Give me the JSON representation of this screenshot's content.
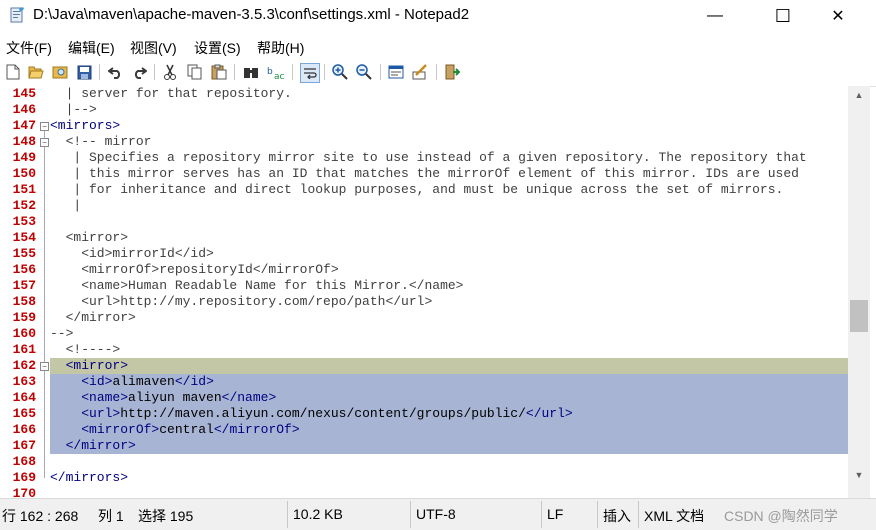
{
  "window": {
    "title": "D:\\Java\\maven\\apache-maven-3.5.3\\conf\\settings.xml - Notepad2",
    "minimize_glyph": "—",
    "maximize_glyph": "☐",
    "close_glyph": "✕"
  },
  "menu": {
    "items": [
      "文件(F)",
      "编辑(E)",
      "视图(V)",
      "设置(S)",
      "帮助(H)"
    ]
  },
  "toolbar": {
    "icons": [
      "new-file-icon",
      "open-file-icon",
      "browse-icon",
      "save-icon",
      "undo-icon",
      "redo-icon",
      "cut-icon",
      "copy-icon",
      "paste-icon",
      "find-icon",
      "replace-icon",
      "word-wrap-icon",
      "zoom-in-icon",
      "zoom-out-icon",
      "select-scheme-icon",
      "customize-scheme-icon",
      "exit-icon"
    ]
  },
  "editor": {
    "colors": {
      "tag": "#000080",
      "comment": "#404040",
      "line_number": "#c00000",
      "selection": "#a8b4d4",
      "caret_line": "#c3c7a6"
    },
    "lines": [
      {
        "num": "145",
        "text": "  | server for that repository."
      },
      {
        "num": "146",
        "text": "  |-->"
      },
      {
        "num": "147",
        "text": "<mirrors>"
      },
      {
        "num": "148",
        "text": "  <!-- mirror"
      },
      {
        "num": "149",
        "text": "   | Specifies a repository mirror site to use instead of a given repository. The repository that"
      },
      {
        "num": "150",
        "text": "   | this mirror serves has an ID that matches the mirrorOf element of this mirror. IDs are used"
      },
      {
        "num": "151",
        "text": "   | for inheritance and direct lookup purposes, and must be unique across the set of mirrors."
      },
      {
        "num": "152",
        "text": "   |"
      },
      {
        "num": "153",
        "text": ""
      },
      {
        "num": "154",
        "text": "  <mirror>"
      },
      {
        "num": "155",
        "text": "    <id>mirrorId</id>"
      },
      {
        "num": "156",
        "text": "    <mirrorOf>repositoryId</mirrorOf>"
      },
      {
        "num": "157",
        "text": "    <name>Human Readable Name for this Mirror.</name>"
      },
      {
        "num": "158",
        "text": "    <url>http://my.repository.com/repo/path</url>"
      },
      {
        "num": "159",
        "text": "  </mirror>"
      },
      {
        "num": "160",
        "text": "-->"
      },
      {
        "num": "161",
        "text": "  <!---->"
      },
      {
        "num": "162",
        "text": "  <mirror>"
      },
      {
        "num": "163",
        "text": "    <id>alimaven</id>"
      },
      {
        "num": "164",
        "text": "    <name>aliyun maven</name>"
      },
      {
        "num": "165",
        "text": "    <url>http://maven.aliyun.com/nexus/content/groups/public/</url>"
      },
      {
        "num": "166",
        "text": "    <mirrorOf>central</mirrorOf>"
      },
      {
        "num": "167",
        "text": "  </mirror>"
      },
      {
        "num": "168",
        "text": ""
      },
      {
        "num": "169",
        "text": "</mirrors>"
      },
      {
        "num": "170",
        "text": ""
      }
    ]
  },
  "status": {
    "position": "行 162 : 268",
    "column": "列 1",
    "selection": "选择 195",
    "size": "10.2 KB",
    "encoding": "UTF-8",
    "line_ending": "LF",
    "insert_mode": "插入",
    "scheme": "XML 文档",
    "watermark": "CSDN @陶然同学"
  }
}
